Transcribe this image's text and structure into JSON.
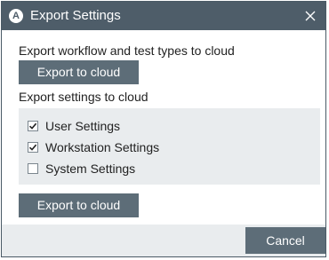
{
  "window": {
    "title": "Export Settings",
    "app_icon_letter": "A",
    "close_glyph": "×"
  },
  "workflow_section": {
    "label": "Export workflow and test types to cloud",
    "button_label": "Export to cloud"
  },
  "settings_section": {
    "label": "Export settings to cloud",
    "options": [
      {
        "label": "User Settings",
        "checked": true
      },
      {
        "label": "Workstation Settings",
        "checked": true
      },
      {
        "label": "System Settings",
        "checked": false
      }
    ],
    "button_label": "Export to cloud"
  },
  "footer": {
    "cancel_label": "Cancel"
  },
  "colors": {
    "titlebar": "#4e5d69",
    "button": "#5d6d78",
    "panel": "#e9ecee"
  }
}
